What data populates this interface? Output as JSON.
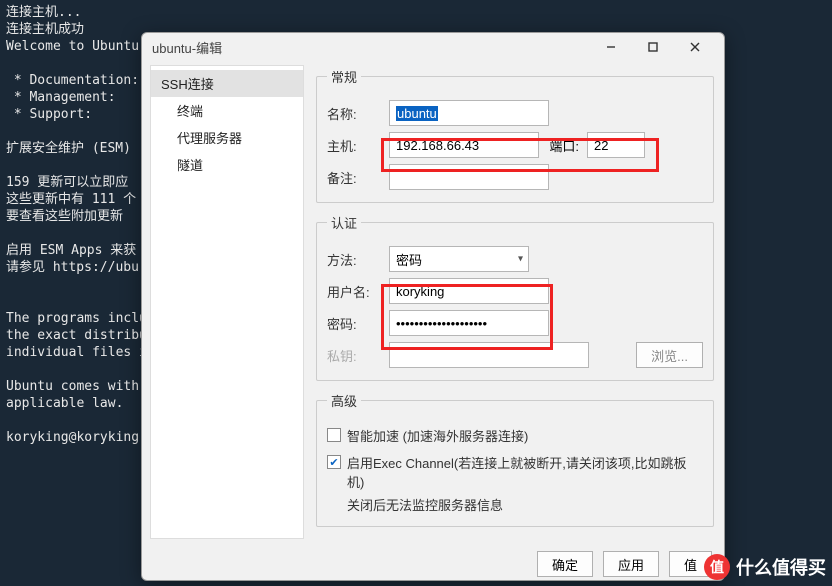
{
  "terminal": {
    "lines": "连接主机...\n连接主机成功\nWelcome to Ubuntu\n\n * Documentation:\n * Management:\n * Support:\n\n扩展安全维护 (ESM)\n\n159 更新可以立即应\n这些更新中有 111 个\n要查看这些附加更新\n\n启用 ESM Apps 来获\n请参见 https://ubu\n\n\nThe programs inclu\nthe exact distribu\nindividual files i\n\nUbuntu comes with \napplicable law.\n\nkoryking@koryking-"
  },
  "dialog": {
    "title": "ubuntu-编辑"
  },
  "sidebar": {
    "items": [
      {
        "label": "SSH连接",
        "children": [
          "终端",
          "代理服务器",
          "隧道"
        ]
      }
    ]
  },
  "general": {
    "legend": "常规",
    "name_label": "名称:",
    "name_value": "ubuntu",
    "host_label": "主机:",
    "host_value": "192.168.66.43",
    "port_label": "端口:",
    "port_value": "22",
    "remark_label": "备注:",
    "remark_value": ""
  },
  "auth": {
    "legend": "认证",
    "method_label": "方法:",
    "method_value": "密码",
    "user_label": "用户名:",
    "user_value": "koryking",
    "pass_label": "密码:",
    "pass_value": "••••••••••••••••••••",
    "key_label": "私钥:",
    "key_value": "",
    "browse_label": "浏览..."
  },
  "advanced": {
    "legend": "高级",
    "opt1_checked": false,
    "opt1_label": "智能加速 (加速海外服务器连接)",
    "opt2_checked": true,
    "opt2_label": "启用Exec Channel(若连接上就被断开,请关闭该项,比如跳板机)",
    "opt2_note": "关闭后无法监控服务器信息"
  },
  "footer": {
    "ok": "确定",
    "apply": "应用",
    "cancel": "值"
  },
  "watermark": "什么值得买"
}
